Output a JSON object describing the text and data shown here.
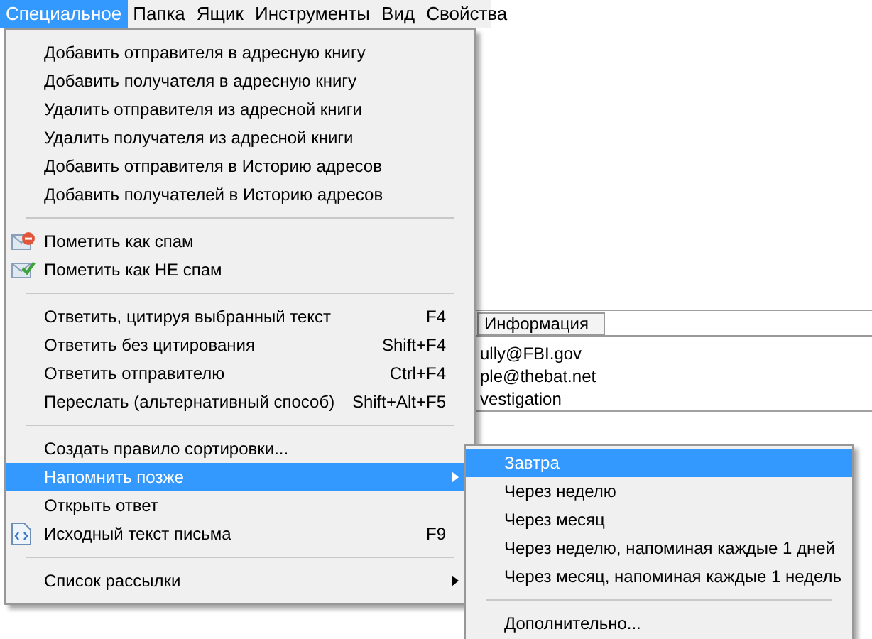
{
  "menubar": [
    {
      "label": "Специальное",
      "selected": true
    },
    {
      "label": "Папка",
      "selected": false
    },
    {
      "label": "Ящик",
      "selected": false
    },
    {
      "label": "Инструменты",
      "selected": false
    },
    {
      "label": "Вид",
      "selected": false
    },
    {
      "label": "Свойства",
      "selected": false
    }
  ],
  "background_window": {
    "tab": "Информация",
    "lines": [
      "ully@FBI.gov",
      "ple@thebat.net",
      "vestigation"
    ]
  },
  "menu": [
    {
      "kind": "item",
      "label": "Добавить отправителя в адресную книгу",
      "selected": false
    },
    {
      "kind": "item",
      "label": "Добавить получателя в адресную книгу",
      "selected": false
    },
    {
      "kind": "item",
      "label": "Удалить отправителя из адресной книги",
      "selected": false
    },
    {
      "kind": "item",
      "label": "Удалить получателя из адресной книги",
      "selected": false
    },
    {
      "kind": "item",
      "label": "Добавить отправителя в Историю адресов",
      "selected": false
    },
    {
      "kind": "item",
      "label": "Добавить получателей в Историю адресов",
      "selected": false
    },
    {
      "kind": "separator"
    },
    {
      "kind": "spam",
      "label": "Пометить как спам",
      "selected": false
    },
    {
      "kind": "not-spam",
      "label": "Пометить как НЕ спам",
      "selected": false
    },
    {
      "kind": "separator"
    },
    {
      "kind": "item",
      "label": "Ответить, цитируя выбранный текст",
      "shortcut": "F4",
      "selected": false
    },
    {
      "kind": "item",
      "label": "Ответить без цитирования",
      "shortcut": "Shift+F4",
      "selected": false
    },
    {
      "kind": "item",
      "label": "Ответить отправителю",
      "shortcut": "Ctrl+F4",
      "selected": false
    },
    {
      "kind": "item",
      "label": "Переслать (альтернативный способ)",
      "shortcut": "Shift+Alt+F5",
      "selected": false
    },
    {
      "kind": "separator"
    },
    {
      "kind": "item",
      "label": "Создать правило сортировки...",
      "selected": false
    },
    {
      "kind": "submenu",
      "label": "Напомнить позже",
      "selected": true
    },
    {
      "kind": "item",
      "label": "Открыть ответ",
      "selected": false
    },
    {
      "kind": "source",
      "label": "Исходный текст письма",
      "shortcut": "F9",
      "selected": false
    },
    {
      "kind": "separator"
    },
    {
      "kind": "submenu",
      "label": "Список рассылки",
      "selected": false
    }
  ],
  "submenu": [
    {
      "kind": "item",
      "label": "Завтра",
      "selected": true
    },
    {
      "kind": "item",
      "label": "Через неделю",
      "selected": false
    },
    {
      "kind": "item",
      "label": "Через месяц",
      "selected": false
    },
    {
      "kind": "item",
      "label": "Через неделю, напоминая каждые 1 дней",
      "selected": false
    },
    {
      "kind": "item",
      "label": "Через месяц, напоминая каждые 1 недель",
      "selected": false
    },
    {
      "kind": "separator"
    },
    {
      "kind": "item",
      "label": "Дополнительно...",
      "selected": false
    }
  ]
}
